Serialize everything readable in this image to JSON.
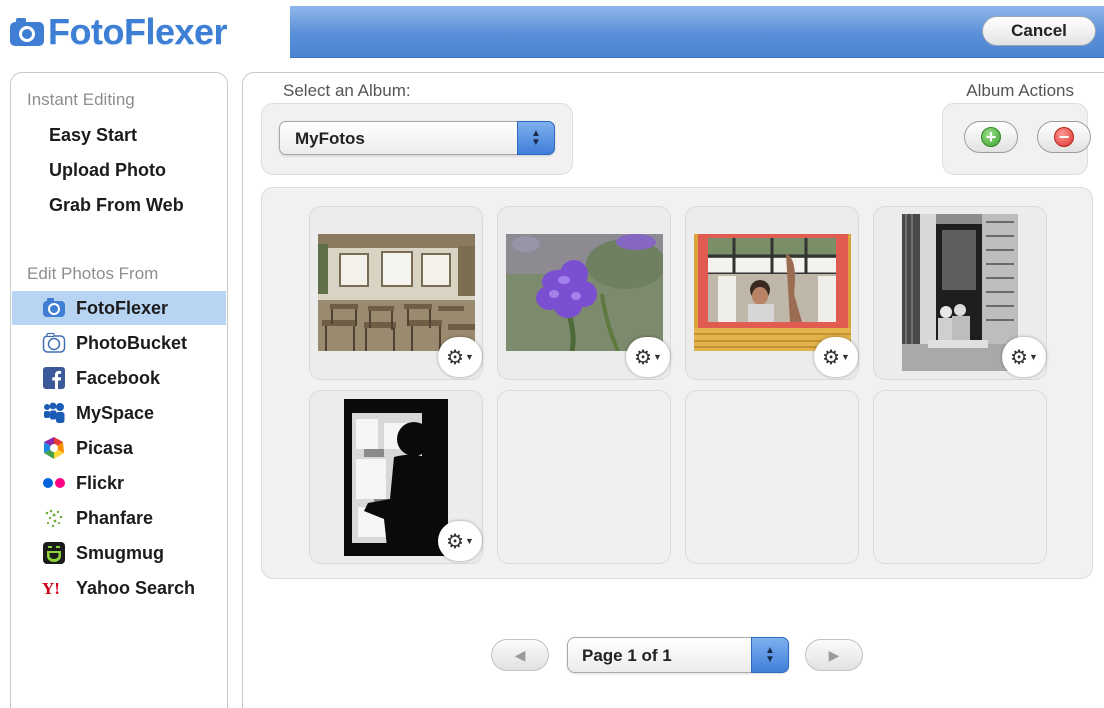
{
  "header": {
    "brand": "FotoFlexer",
    "cancel_label": "Cancel",
    "brand_color": "#3c7fd4"
  },
  "sidebar": {
    "instant_heading": "Instant Editing",
    "instant_links": [
      "Easy Start",
      "Upload Photo",
      "Grab From Web"
    ],
    "edit_heading": "Edit Photos From",
    "sources": [
      {
        "label": "FotoFlexer",
        "icon": "fotoflexer-camera-icon",
        "active": true
      },
      {
        "label": "PhotoBucket",
        "icon": "photobucket-icon",
        "active": false
      },
      {
        "label": "Facebook",
        "icon": "facebook-icon",
        "active": false
      },
      {
        "label": "MySpace",
        "icon": "myspace-icon",
        "active": false
      },
      {
        "label": "Picasa",
        "icon": "picasa-icon",
        "active": false
      },
      {
        "label": "Flickr",
        "icon": "flickr-icon",
        "active": false
      },
      {
        "label": "Phanfare",
        "icon": "phanfare-icon",
        "active": false
      },
      {
        "label": "Smugmug",
        "icon": "smugmug-icon",
        "active": false
      },
      {
        "label": "Yahoo Search",
        "icon": "yahoo-icon",
        "active": false
      }
    ]
  },
  "album": {
    "label": "Select an Album:",
    "selected": "MyFotos",
    "actions_label": "Album Actions"
  },
  "photos": [
    {
      "kind": "classroom",
      "has_menu": true
    },
    {
      "kind": "purple-flower",
      "has_menu": true
    },
    {
      "kind": "child-in-window",
      "has_menu": true
    },
    {
      "kind": "bw-doorway-children",
      "has_menu": true
    },
    {
      "kind": "bw-silhouette-window",
      "has_menu": true
    }
  ],
  "pagination": {
    "page_label": "Page 1 of 1",
    "prev_icon": "left-arrow-icon",
    "next_icon": "right-arrow-icon"
  }
}
